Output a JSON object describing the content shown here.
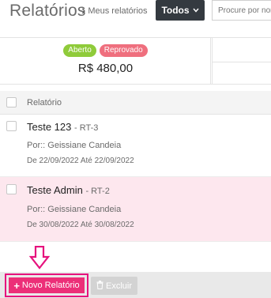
{
  "header": {
    "title": "Relatórios",
    "breadcrumb_caret": "›",
    "breadcrumb": "Meus relatórios",
    "filter_label": "Todos",
    "search_placeholder": "Procure por nom"
  },
  "summary": {
    "badges": [
      {
        "label": "Aberto",
        "color": "#8fcb3a"
      },
      {
        "label": "Reprovado",
        "color": "#ef6f7e"
      }
    ],
    "amount": "R$ 480,00"
  },
  "table": {
    "header_label": "Relatório",
    "rows": [
      {
        "title": "Teste 123",
        "code": "- RT-3",
        "by": "Por:: Geissiane Candeia",
        "dates": "De 22/09/2022 Até 22/09/2022",
        "highlight": false
      },
      {
        "title": "Teste Admin",
        "code": "- RT-2",
        "by": "Por:: Geissiane Candeia",
        "dates": "De 30/08/2022 Até 30/08/2022",
        "highlight": true
      }
    ]
  },
  "footer": {
    "new_icon": "+",
    "new_label": "Novo Relatório",
    "delete_label": "Excluir"
  },
  "colors": {
    "accent": "#ec2f78",
    "annotation": "#e6127d",
    "filter_bg": "#343a40",
    "highlight_row": "#fde7ee"
  }
}
